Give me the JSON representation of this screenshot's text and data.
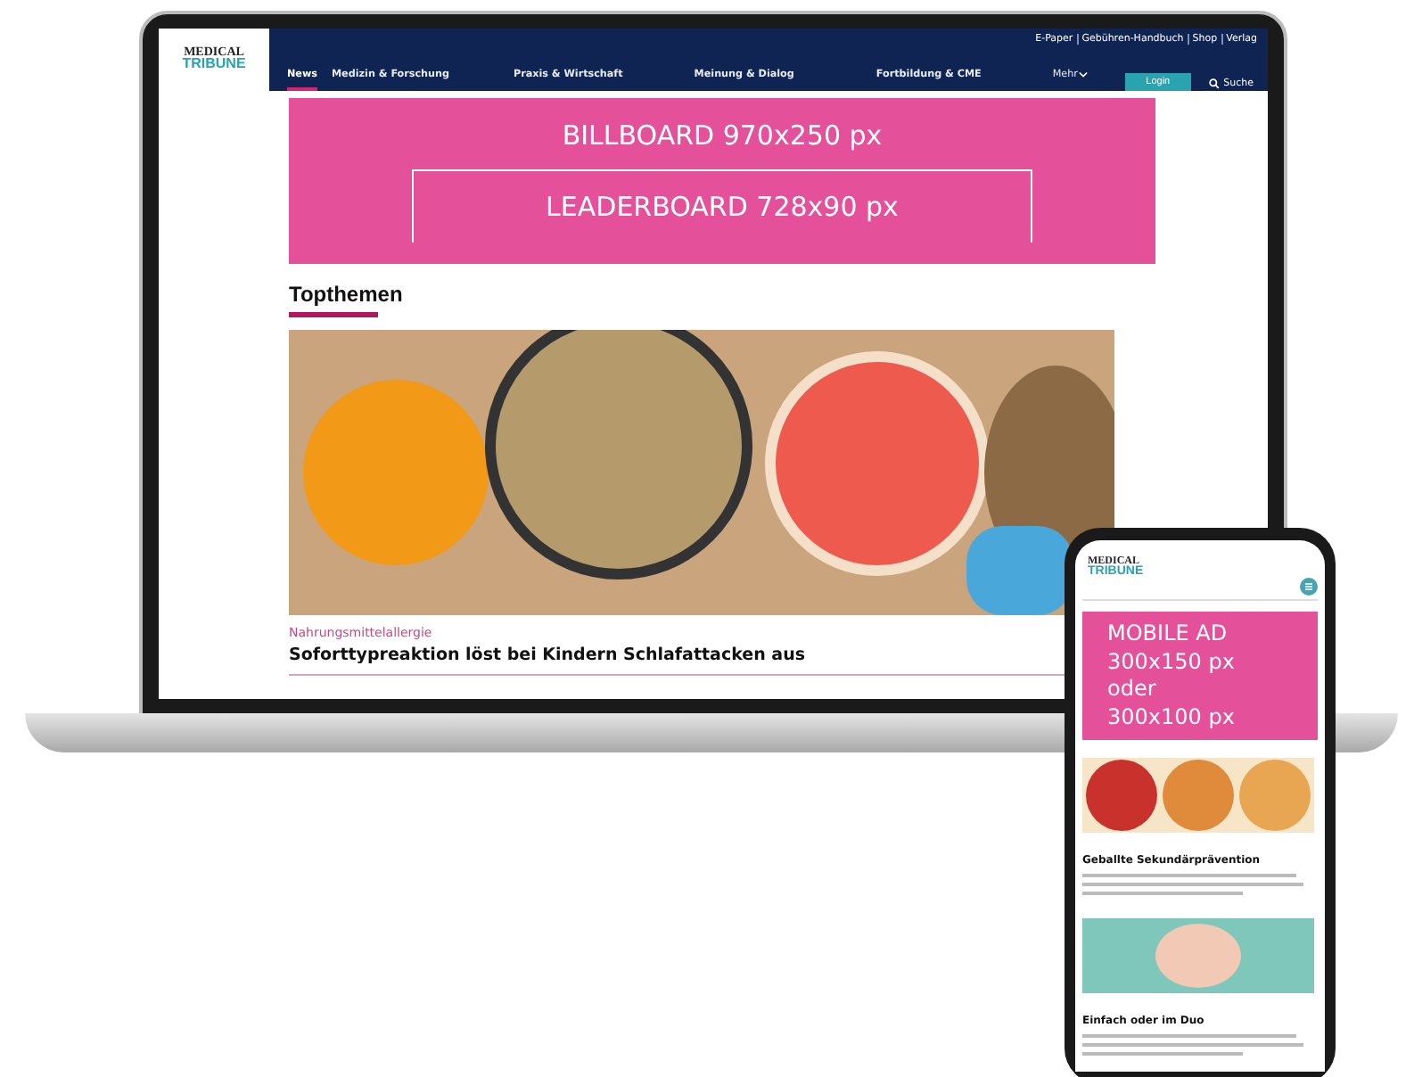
{
  "laptop": {
    "logo": [
      "MEDICAL",
      "TRIBUNE"
    ],
    "top_links": [
      "E-Paper",
      "Gebühren-Handbuch",
      "Shop",
      "Verlag"
    ],
    "nav": [
      {
        "label": "News",
        "selected": true
      },
      {
        "label": "Medizin & Forschung",
        "selected": false
      },
      {
        "label": "Praxis & Wirtschaft",
        "selected": false
      },
      {
        "label": "Meinung & Dialog",
        "selected": false
      },
      {
        "label": "Fortbildung & CME",
        "selected": false
      },
      {
        "label": "Mehr",
        "selected": false,
        "kind": "dropdown"
      }
    ],
    "login": "Login",
    "search": "Suche",
    "billboard": "BILLBOARD 970x250 px",
    "leaderboard": "LEADERBOARD 728x90 px",
    "section_title": "Topthemen",
    "article": {
      "kicker": "Nahrungsmittelallergie",
      "headline": "Soforttypreaktion löst bei Kindern Schlafattacken aus"
    }
  },
  "phone": {
    "logo": [
      "MEDICAL",
      "TRIBUNE"
    ],
    "ad": [
      "MOBILE AD",
      "300x150 px",
      "oder",
      "300x100 px"
    ],
    "articles": [
      {
        "title": "Geballte Sekundärprävention"
      },
      {
        "title": "Einfach oder im Duo"
      }
    ]
  }
}
